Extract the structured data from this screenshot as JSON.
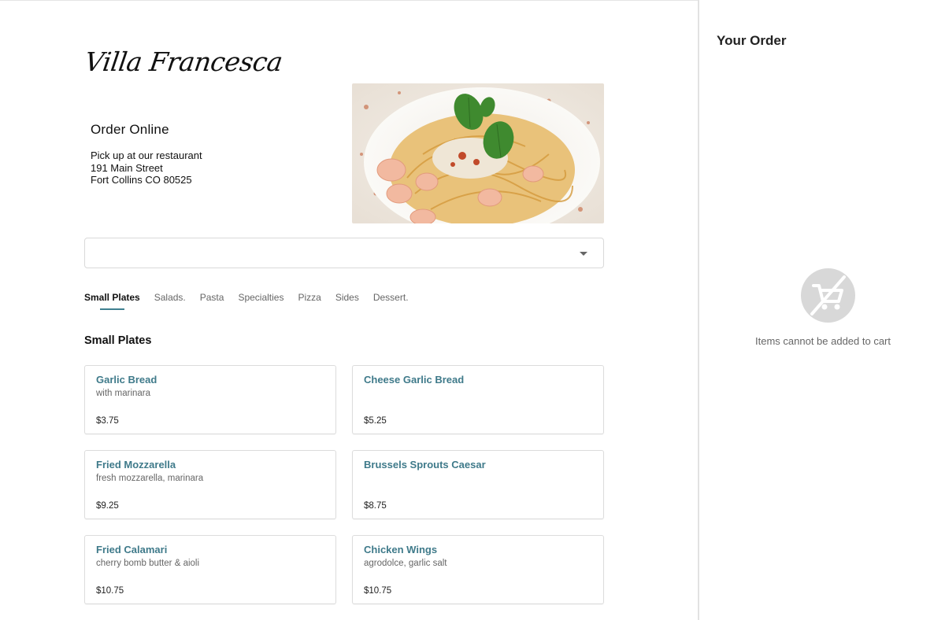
{
  "restaurant": {
    "name": "Villa Francesca",
    "order_heading": "Order Online",
    "pickup_lines": [
      "Pick up at our restaurant",
      "191 Main Street",
      "Fort Collins CO 80525"
    ]
  },
  "menu_select": {
    "value": ""
  },
  "tabs": [
    {
      "label": "Small Plates",
      "active": true
    },
    {
      "label": "Salads.",
      "active": false
    },
    {
      "label": "Pasta",
      "active": false
    },
    {
      "label": "Specialties",
      "active": false
    },
    {
      "label": "Pizza",
      "active": false
    },
    {
      "label": "Sides",
      "active": false
    },
    {
      "label": "Dessert.",
      "active": false
    }
  ],
  "section": {
    "title": "Small Plates"
  },
  "items": [
    {
      "name": "Garlic Bread",
      "desc": "with marinara",
      "price": "$3.75"
    },
    {
      "name": "Cheese Garlic Bread",
      "desc": "",
      "price": "$5.25"
    },
    {
      "name": "Fried Mozzarella",
      "desc": "fresh mozzarella, marinara",
      "price": "$9.25"
    },
    {
      "name": "Brussels Sprouts Caesar",
      "desc": "",
      "price": "$8.75"
    },
    {
      "name": "Fried Calamari",
      "desc": "cherry bomb butter & aioli",
      "price": "$10.75"
    },
    {
      "name": "Chicken Wings",
      "desc": "agrodolce, garlic salt",
      "price": "$10.75"
    }
  ],
  "order": {
    "title": "Your Order",
    "empty_message": "Items cannot be added to cart",
    "icon": "no-cart-icon"
  },
  "colors": {
    "accent": "#3f7a8a",
    "tab_underline": "#3f8090",
    "icon_bg": "#d8d8d8"
  }
}
